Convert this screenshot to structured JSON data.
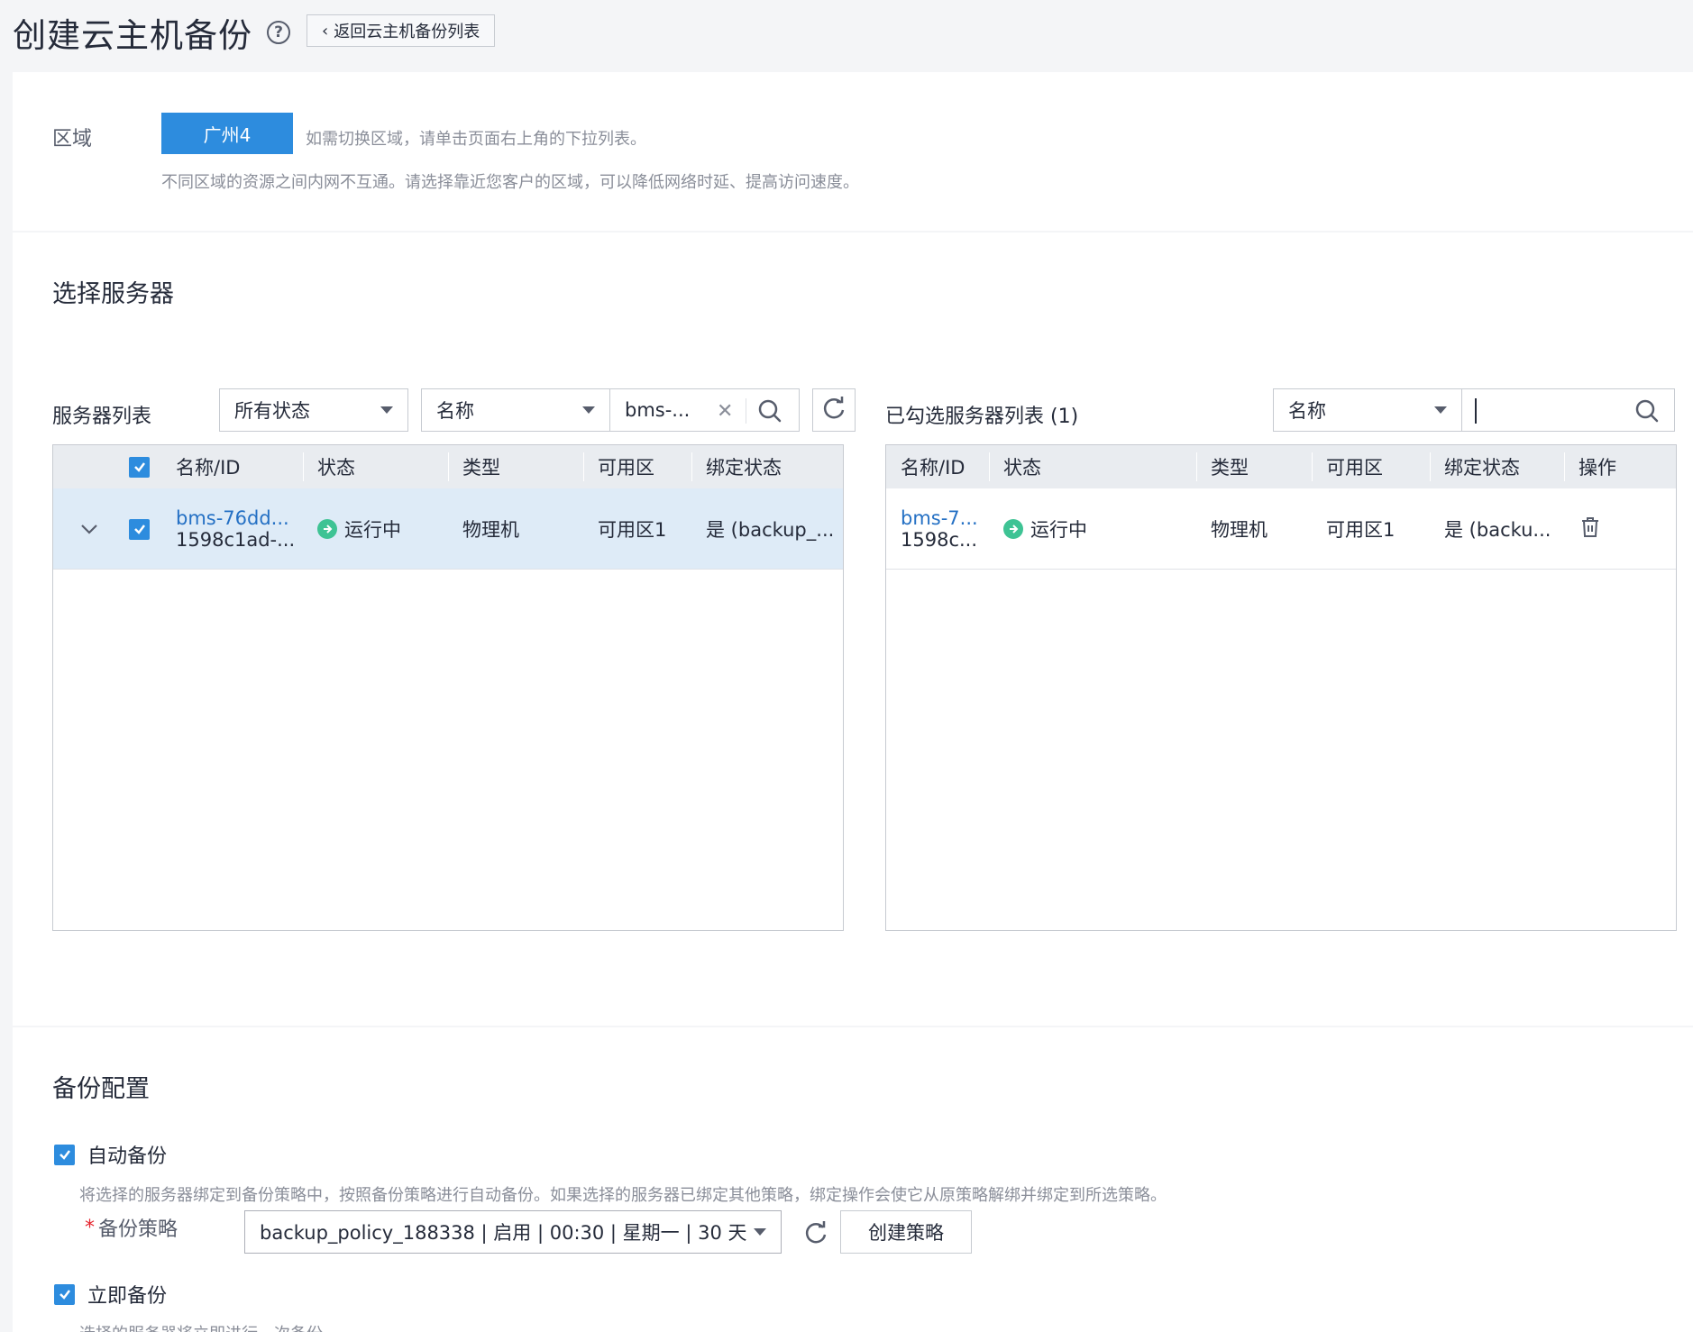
{
  "header": {
    "title": "创建云主机备份",
    "back_label": "返回云主机备份列表"
  },
  "region": {
    "label": "区域",
    "selected": "广州4",
    "hint1": "如需切换区域，请单击页面右上角的下拉列表。",
    "hint2": "不同区域的资源之间内网不互通。请选择靠近您客户的区域，可以降低网络时延、提高访问速度。"
  },
  "server_section": {
    "title": "选择服务器",
    "list_label": "服务器列表",
    "status_filter": "所有状态",
    "search_field": "名称",
    "search_value": "bms-...",
    "columns": [
      "名称/ID",
      "状态",
      "类型",
      "可用区",
      "绑定状态"
    ],
    "rows": [
      {
        "name": "bms-76dd...",
        "id": "1598c1ad-...",
        "status": "运行中",
        "type": "物理机",
        "az": "可用区1",
        "binding": "是 (backup_..."
      }
    ]
  },
  "selected_section": {
    "title": "已勾选服务器列表 (1)",
    "search_field": "名称",
    "search_value": "",
    "columns": [
      "名称/ID",
      "状态",
      "类型",
      "可用区",
      "绑定状态",
      "操作"
    ],
    "rows": [
      {
        "name": "bms-7...",
        "id": "1598c...",
        "status": "运行中",
        "type": "物理机",
        "az": "可用区1",
        "binding": "是 (backu..."
      }
    ]
  },
  "backup_config": {
    "title": "备份配置",
    "auto_label": "自动备份",
    "auto_hint": "将选择的服务器绑定到备份策略中，按照备份策略进行自动备份。如果选择的服务器已绑定其他策略，绑定操作会使它从原策略解绑并绑定到所选策略。",
    "policy_label": "备份策略",
    "policy_value": "backup_policy_188338 | 启用 | 00:30 | 星期一 | 30 天",
    "create_policy": "创建策略",
    "immediate_label": "立即备份",
    "immediate_hint": "选择的服务器将立即进行一次备份。"
  },
  "colors": {
    "primary": "#2d8cde",
    "link": "#2470c4",
    "running": "#3ec394",
    "row_selected": "#deebf7"
  }
}
